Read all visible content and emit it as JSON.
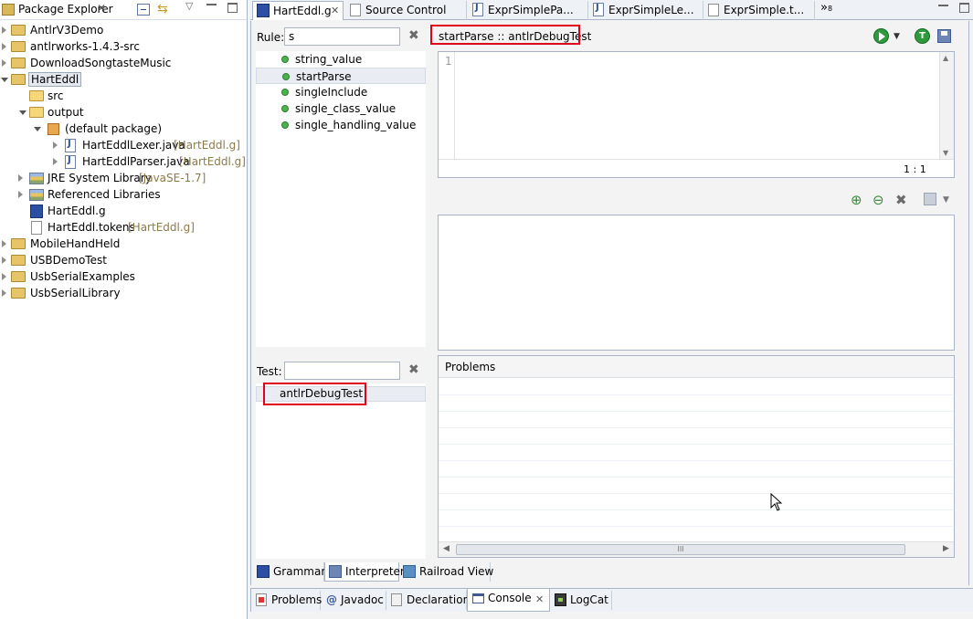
{
  "explorer": {
    "title": "Package Explorer",
    "items": [
      {
        "label": "AntlrV3Demo",
        "suffix": ""
      },
      {
        "label": "antlrworks-1.4.3-src",
        "suffix": ""
      },
      {
        "label": "DownloadSongtasteMusic",
        "suffix": ""
      },
      {
        "label": "HartEddl",
        "suffix": ""
      },
      {
        "label": "src",
        "suffix": ""
      },
      {
        "label": "output",
        "suffix": ""
      },
      {
        "label": "(default package)",
        "suffix": ""
      },
      {
        "label": "HartEddlLexer.java",
        "suffix": "[HartEddl.g]"
      },
      {
        "label": "HartEddlParser.java",
        "suffix": "[HartEddl.g]"
      },
      {
        "label": "JRE System Library",
        "suffix": "[JavaSE-1.7]"
      },
      {
        "label": "Referenced Libraries",
        "suffix": ""
      },
      {
        "label": "HartEddl.g",
        "suffix": ""
      },
      {
        "label": "HartEddl.tokens",
        "suffix": "[HartEddl.g]"
      },
      {
        "label": "MobileHandHeld",
        "suffix": ""
      },
      {
        "label": "USBDemoTest",
        "suffix": ""
      },
      {
        "label": "UsbSerialExamples",
        "suffix": ""
      },
      {
        "label": "UsbSerialLibrary",
        "suffix": ""
      }
    ]
  },
  "editor_tabs": {
    "tabs": [
      "HartEddl.g",
      "Source Control",
      "ExprSimplePa...",
      "ExprSimpleLe...",
      "ExprSimple.t..."
    ],
    "overflow": "»",
    "overflow_count": "8"
  },
  "interpreter": {
    "rule_label": "Rule:",
    "rule_value": "s",
    "rules": [
      "string_value",
      "startParse",
      "singleInclude",
      "single_class_value",
      "single_handling_value"
    ],
    "selected_rule": "startParse",
    "context_title": "startParse :: antlrDebugTest",
    "line_number": "1",
    "cursor_pos": "1 : 1",
    "test_label": "Test:",
    "test_value": "",
    "tests": [
      "antlrDebugTest"
    ],
    "problems_header": "Problems",
    "scroll_handle": "III"
  },
  "mode_tabs": [
    "Grammar",
    "Interpreter",
    "Railroad View"
  ],
  "bottom_tabs": [
    "Problems",
    "Javadoc",
    "Declaration",
    "Console",
    "LogCat"
  ],
  "colors": {
    "highlight": "#e0001c",
    "selection": "#e9edf3",
    "run": "#2e9a3c"
  }
}
